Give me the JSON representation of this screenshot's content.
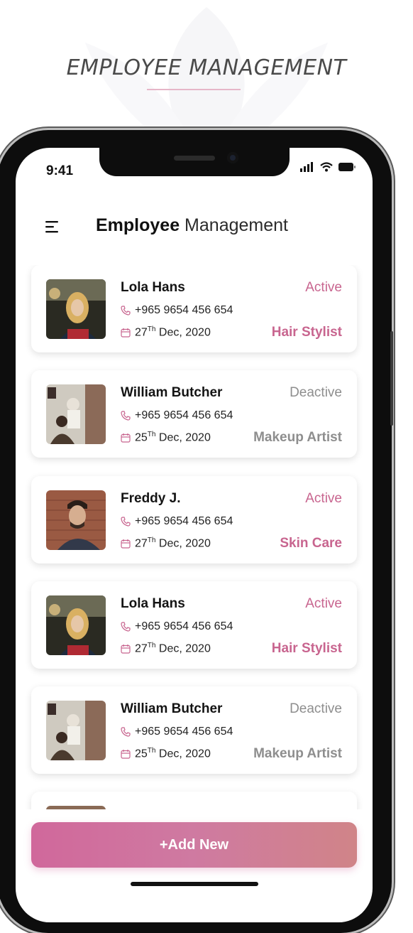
{
  "promo": {
    "title": "EMPLOYEE MANAGEMENT"
  },
  "status_bar": {
    "time": "9:41",
    "icons": [
      "signal-icon",
      "wifi-icon",
      "battery-icon"
    ]
  },
  "header": {
    "title_bold": "Employee",
    "title_rest": " Management",
    "menu_icon": "menu-icon"
  },
  "colors": {
    "accent": "#c8658f",
    "active": "#c8658f",
    "deactive": "#8e8e8e",
    "button_gradient_start": "#d0689b",
    "button_gradient_end": "#d08488"
  },
  "employees": [
    {
      "name": "Lola Hans",
      "status": "Active",
      "phone": "+965 9654 456 654",
      "date_day": "27",
      "date_suffix": "Th",
      "date_rest": " Dec, 2020",
      "role": "Hair Stylist"
    },
    {
      "name": "William Butcher",
      "status": "Deactive",
      "phone": "+965 9654 456 654",
      "date_day": "25",
      "date_suffix": "Th",
      "date_rest": " Dec, 2020",
      "role": "Makeup Artist"
    },
    {
      "name": "Freddy J.",
      "status": "Active",
      "phone": "+965 9654 456 654",
      "date_day": "27",
      "date_suffix": "Th",
      "date_rest": " Dec, 2020",
      "role": "Skin Care"
    },
    {
      "name": "Lola Hans",
      "status": "Active",
      "phone": "+965 9654 456 654",
      "date_day": "27",
      "date_suffix": "Th",
      "date_rest": " Dec, 2020",
      "role": "Hair Stylist"
    },
    {
      "name": "William Butcher",
      "status": "Deactive",
      "phone": "+965 9654 456 654",
      "date_day": "25",
      "date_suffix": "Th",
      "date_rest": " Dec, 2020",
      "role": "Makeup Artist"
    }
  ],
  "add_button": {
    "label": "+Add New"
  }
}
